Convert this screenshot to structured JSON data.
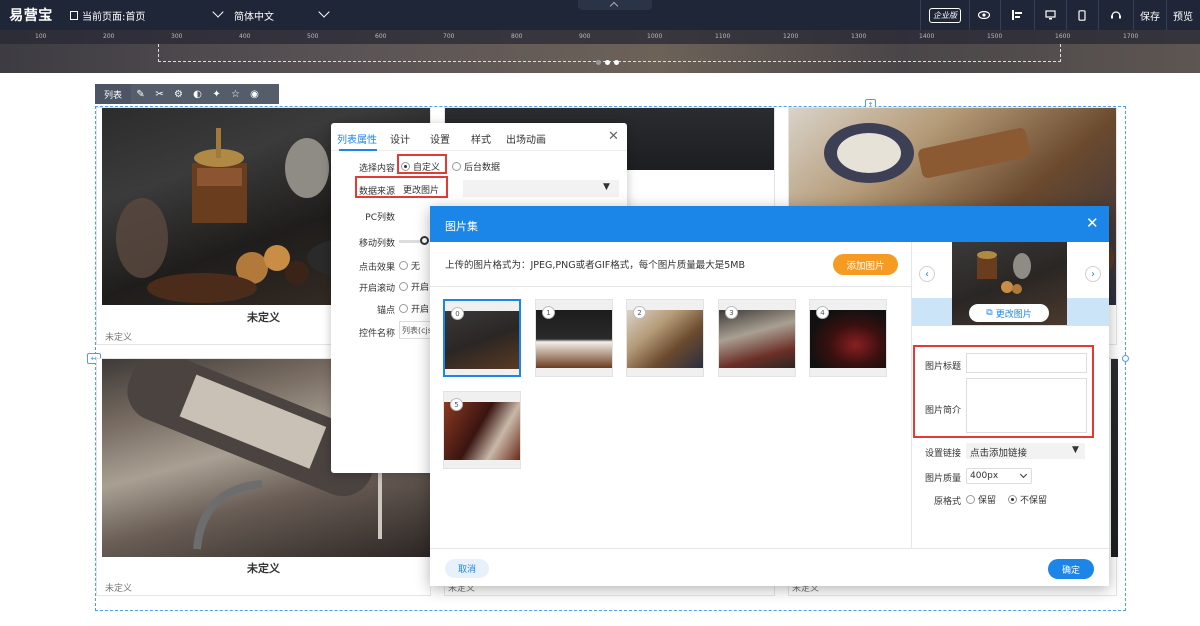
{
  "topbar": {
    "logo": "易营宝",
    "current_page": "当前页面:首页",
    "language": "简体中文",
    "enterprise_badge": "企业版",
    "save": "保存",
    "preview": "预览"
  },
  "ruler_ticks": [
    "100",
    "200",
    "300",
    "400",
    "500",
    "600",
    "700",
    "800",
    "900",
    "1000",
    "1100",
    "1200",
    "1300",
    "1400",
    "1500",
    "1600",
    "1700"
  ],
  "module_toolbar": {
    "title": "列表"
  },
  "cards": [
    {
      "title": "未定义",
      "desc": "未定义"
    },
    {
      "title": "未定义",
      "desc": "未定义"
    },
    {
      "title": "",
      "desc": "未定义"
    },
    {
      "title": "",
      "desc": "未定义"
    }
  ],
  "prop_panel": {
    "tabs": [
      "列表属性",
      "设计",
      "设置",
      "样式",
      "出场动画"
    ],
    "select_content_label": "选择内容",
    "option_custom": "自定义",
    "option_backend": "后台数据",
    "data_source_label": "数据来源",
    "data_source_value": "更改图片",
    "pc_columns_label": "PC列数",
    "mobile_columns_label": "移动列数",
    "click_effect_label": "点击效果",
    "click_effect_value": "无",
    "scroll_label": "开启滚动",
    "scroll_value": "开启",
    "anchor_label": "锚点",
    "anchor_value": "开启",
    "control_name_label": "控件名称",
    "control_name_value": "列表(cjs"
  },
  "dialog": {
    "title": "图片集",
    "hint": "上传的图片格式为：JPEG,PNG或者GIF格式，每个图片质量最大是5MB",
    "add_button": "添加图片",
    "thumbs": [
      "0",
      "1",
      "2",
      "3",
      "4",
      "5"
    ],
    "change_button": "更改图片",
    "image_title_label": "图片标题",
    "image_desc_label": "图片简介",
    "link_label": "设置链接",
    "link_value": "点击添加链接",
    "quality_label": "图片质量",
    "quality_value": "400px",
    "original_label": "原格式",
    "keep": "保留",
    "not_keep": "不保留",
    "cancel": "取消",
    "ok": "确定"
  },
  "colors": {
    "accent": "#1c86e8",
    "orange": "#f59a23",
    "highlight": "#e53935",
    "toolbar": "#1e2637"
  }
}
